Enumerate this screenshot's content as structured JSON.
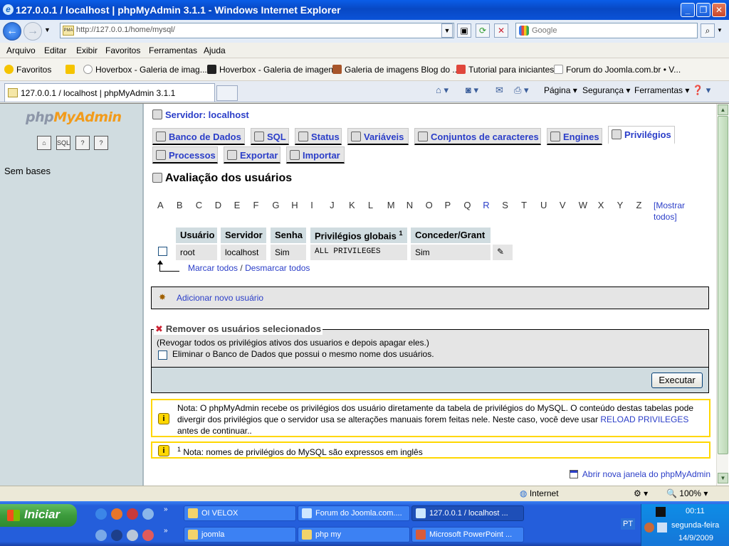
{
  "window": {
    "title": "127.0.0.1 / localhost | phpMyAdmin 3.1.1 - Windows Internet Explorer",
    "address": "http://127.0.0.1/home/mysql/",
    "search_placeholder": "Google"
  },
  "menu": [
    "Arquivo",
    "Editar",
    "Exibir",
    "Favoritos",
    "Ferramentas",
    "Ajuda"
  ],
  "favorites": {
    "label": "Favoritos",
    "items": [
      "Hoverbox - Galeria de imag...",
      "Hoverbox - Galeria de imagens",
      "Galeria de imagens Blog do ...",
      "Tutorial para iniciantes",
      "Forum do Joomla.com.br • V..."
    ]
  },
  "browser_tab": {
    "label": "127.0.0.1 / localhost | phpMyAdmin 3.1.1"
  },
  "command_bar": {
    "page": "Página",
    "security": "Segurança",
    "tools": "Ferramentas"
  },
  "left_panel": {
    "logo_a": "php",
    "logo_b": "MyAdmin",
    "no_databases": "Sem bases"
  },
  "main": {
    "server": "Servidor: localhost",
    "tabs": [
      "Banco de Dados",
      "SQL",
      "Status",
      "Variáveis",
      "Conjuntos de caracteres",
      "Engines",
      "Privilégios",
      "Processos",
      "Exportar",
      "Importar"
    ],
    "page_title": "Avaliação dos usuários",
    "letters": [
      "A",
      "B",
      "C",
      "D",
      "E",
      "F",
      "G",
      "H",
      "I",
      "J",
      "K",
      "L",
      "M",
      "N",
      "O",
      "P",
      "Q",
      "R",
      "S",
      "T",
      "U",
      "V",
      "W",
      "X",
      "Y",
      "Z"
    ],
    "show_all": "[Mostrar todos]",
    "table": {
      "headers": [
        "Usuário",
        "Servidor",
        "Senha",
        "Privilégios globais",
        "Conceder/Grant"
      ],
      "footnote_mark": "1",
      "row": {
        "user": "root",
        "host": "localhost",
        "password": "Sim",
        "privileges": "ALL PRIVILEGES",
        "grant": "Sim"
      }
    },
    "mark_all": "Marcar todos",
    "separator": "/",
    "unmark_all": "Desmarcar todos",
    "add_user": "Adicionar novo usuário",
    "remove": {
      "legend": "Remover os usuários selecionados",
      "text": "(Revogar todos os privilégios ativos dos usuarios e depois apagar eles.)",
      "drop_db_label": "Eliminar o Banco de Dados que possui o mesmo nome dos usuários."
    },
    "execute": "Executar",
    "note1_a": "Nota: O phpMyAdmin recebe os privilégios dos usuário diretamente da tabela de privilégios do MySQL. O conteúdo destas tabelas pode divergir dos privilégios que o servidor usa se alterações manuais forem feitas nele. Neste caso, você deve usar ",
    "note1_link": "RELOAD PRIVILEGES",
    "note1_b": " antes de continuar..",
    "note2_mark": "1",
    "note2": " Nota: nomes de privilégios do MySQL são expressos em inglês",
    "new_window": "Abrir nova janela do phpMyAdmin"
  },
  "status": {
    "zone": "Internet",
    "zoom": "100%"
  },
  "taskbar": {
    "start": "Iniciar",
    "buttons": [
      "OI VELOX",
      "Forum do Joomla.com....",
      "127.0.0.1 / localhost ...",
      "joomla",
      "php my",
      "Microsoft PowerPoint ..."
    ],
    "lang": "PT",
    "time": "00:11",
    "day": "segunda-feira",
    "date": "14/9/2009"
  }
}
